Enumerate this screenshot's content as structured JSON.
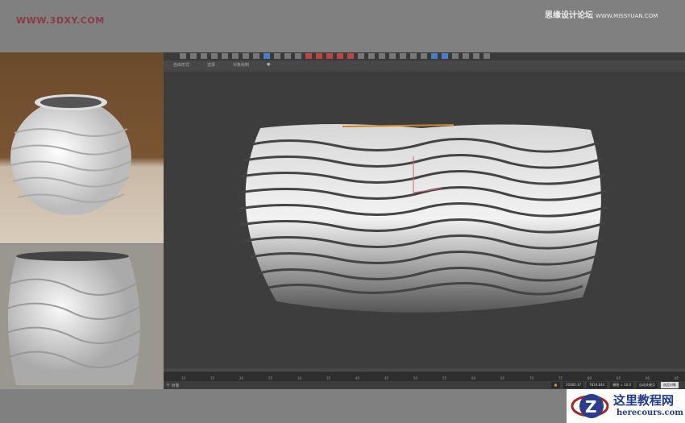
{
  "watermarks": {
    "left": "WWW.3DXY.COM",
    "right_cn": "思缘设计论坛",
    "right_url": "WWW.MISSYUAN.COM"
  },
  "ribbon": {
    "tabs": [
      "自由形式",
      "选择",
      "对象绘制"
    ]
  },
  "timeline": {
    "ticks": [
      "10",
      "15",
      "20",
      "25",
      "30",
      "35",
      "40",
      "45",
      "50",
      "55",
      "60",
      "65",
      "70",
      "75",
      "80",
      "85",
      "90",
      "95"
    ]
  },
  "status": {
    "selection": "个 对象",
    "x": "20060.37",
    "y": "7819.844",
    "grid": "栅格 = 10.0",
    "auto_key": "自动关键点",
    "selected": "选定对象"
  },
  "logo": {
    "title": "这里教程网",
    "url": "herecours.com"
  }
}
